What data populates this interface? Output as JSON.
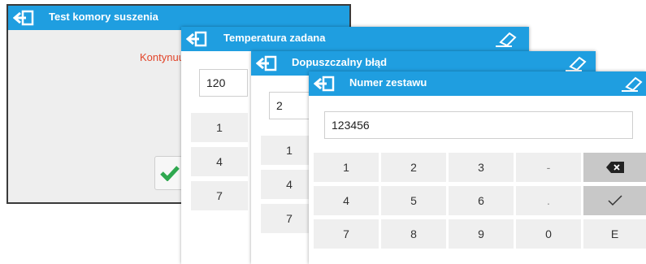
{
  "windows": {
    "test": {
      "title": "Test komory suszenia",
      "message": "Kontynuuj"
    },
    "temperature": {
      "title": "Temperatura zadana",
      "value": "120",
      "keys": [
        "1",
        "4",
        "7"
      ]
    },
    "error": {
      "title": "Dopuszczalny błąd",
      "value": "2",
      "keys": [
        "1",
        "4",
        "7"
      ]
    },
    "set_number": {
      "title": "Numer zestawu",
      "value": "123456",
      "keys": {
        "row1": [
          "1",
          "2",
          "3",
          "-"
        ],
        "row2": [
          "4",
          "5",
          "6",
          "."
        ],
        "row3": [
          "7",
          "8",
          "9",
          "0",
          "E"
        ]
      }
    }
  },
  "icons": {
    "exit": "exit-icon",
    "eraser": "eraser-icon",
    "backspace": "backspace-icon",
    "confirm": "checkmark-icon"
  },
  "colors": {
    "titlebar": "#1f9ee0",
    "continue_text": "#e2452a",
    "confirm_green": "#2fa84f",
    "dark_key": "#c8c8c8",
    "light_key": "#efefef"
  }
}
